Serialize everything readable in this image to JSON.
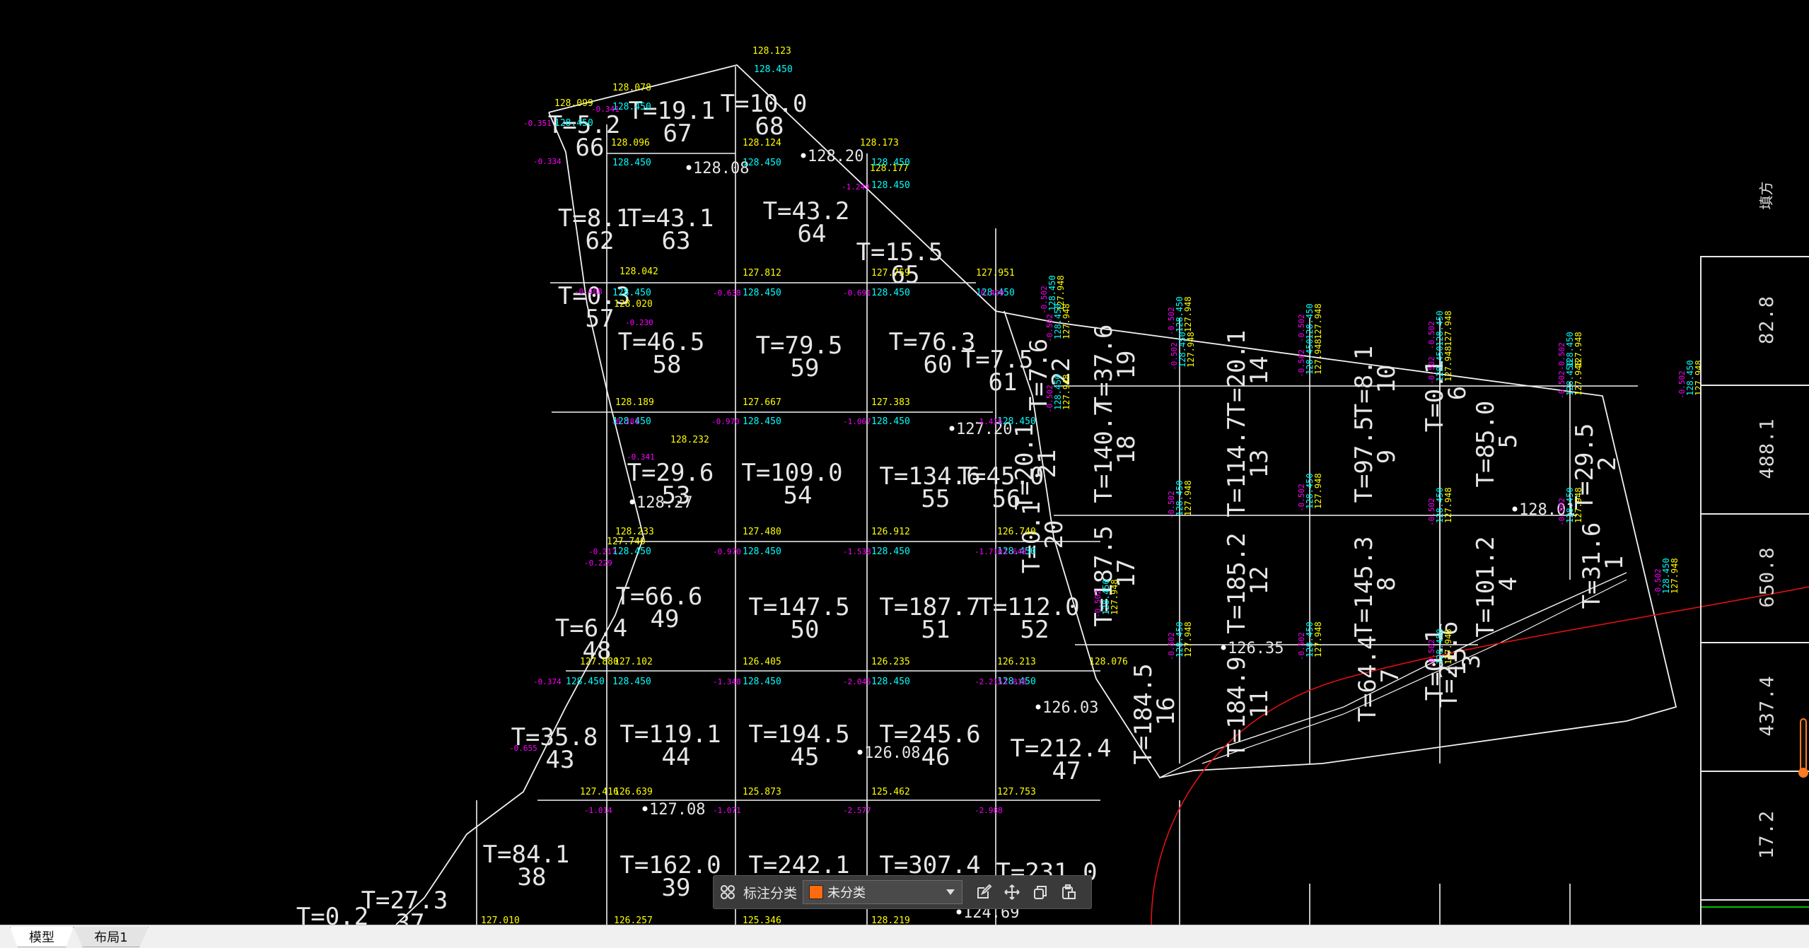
{
  "colors": {
    "canvas_bg": "#000000",
    "grid_line": "#ffffff",
    "elev_yellow": "#ffff00",
    "elev_cyan": "#00ffff",
    "diff_magenta": "#ff00ff",
    "boundary_red": "#e01010",
    "green_line": "#00c000",
    "accent_orange": "#ff6a10"
  },
  "side_panel": {
    "header": "填方",
    "values": [
      "82.8",
      "488.1",
      "650.8",
      "437.4",
      "17.2"
    ]
  },
  "cells": [
    {
      "t": "T=19.1",
      "n": "67"
    },
    {
      "t": "T=10.0",
      "n": "68"
    },
    {
      "t": "T=5.2",
      "n": "66"
    },
    {
      "t": "T=8.1",
      "n": "62"
    },
    {
      "t": "T=43.1",
      "n": "63"
    },
    {
      "t": "T=43.2",
      "n": "64"
    },
    {
      "t": "T=15.5",
      "n": "65"
    },
    {
      "t": "T=0.3",
      "n": "57"
    },
    {
      "t": "T=46.5",
      "n": "58"
    },
    {
      "t": "T=79.5",
      "n": "59"
    },
    {
      "t": "T=76.3",
      "n": "60"
    },
    {
      "t": "T=7.5",
      "n": "61"
    },
    {
      "t": "T=29.6",
      "n": "53"
    },
    {
      "t": "T=109.0",
      "n": "54"
    },
    {
      "t": "T=134.6",
      "n": "55"
    },
    {
      "t": "T=45.0",
      "n": "56"
    },
    {
      "t": "T=6.4",
      "n": "48"
    },
    {
      "t": "T=66.6",
      "n": "49"
    },
    {
      "t": "T=147.5",
      "n": "50"
    },
    {
      "t": "T=187.7",
      "n": "51"
    },
    {
      "t": "T=112.0",
      "n": "52"
    },
    {
      "t": "T=35.8",
      "n": "43"
    },
    {
      "t": "T=119.1",
      "n": "44"
    },
    {
      "t": "T=194.5",
      "n": "45"
    },
    {
      "t": "T=245.6",
      "n": "46"
    },
    {
      "t": "T=212.4",
      "n": "47"
    },
    {
      "t": "T=84.1",
      "n": "38"
    },
    {
      "t": "T=162.0",
      "n": "39"
    },
    {
      "t": "T=242.1",
      "n": "40"
    },
    {
      "t": "T=307.4",
      "n": "41"
    },
    {
      "t": "T=231.0",
      "n": "42"
    },
    {
      "t": "T=27.3",
      "n": "37"
    },
    {
      "t": "T=0.2",
      "n": "36"
    }
  ],
  "rotated_cells": [
    {
      "t": "T=37.6",
      "n": "19"
    },
    {
      "t": "T=20.1",
      "n": "14"
    },
    {
      "t": "T=8.1",
      "n": "10"
    },
    {
      "t": "T=0.1",
      "n": "6"
    },
    {
      "t": "T=140.7",
      "n": "18"
    },
    {
      "t": "T=114.7",
      "n": "13"
    },
    {
      "t": "T=97.5",
      "n": "9"
    },
    {
      "t": "T=85.0",
      "n": "5"
    },
    {
      "t": "T=29.5",
      "n": "2"
    },
    {
      "t": "T=187.5",
      "n": "17"
    },
    {
      "t": "T=185.2",
      "n": "12"
    },
    {
      "t": "T=145.3",
      "n": "8"
    },
    {
      "t": "T=101.2",
      "n": "4"
    },
    {
      "t": "T=31.6",
      "n": "1"
    },
    {
      "t": "T=184.5",
      "n": "16"
    },
    {
      "t": "T=184.9",
      "n": "11"
    },
    {
      "t": "T=64.4",
      "n": "7"
    },
    {
      "t": "T=21.6",
      "n": "3"
    },
    {
      "t": "T=20.1",
      "n": "21"
    },
    {
      "t": "T=7.6",
      "n": "22"
    },
    {
      "t": "T=0.1",
      "n": "20"
    },
    {
      "t": "T=0.1",
      "n": "15"
    }
  ],
  "spot_elevations": [
    "128.08",
    "128.20",
    "127.20",
    "128.27",
    "128.01",
    "126.35",
    "126.03",
    "126.08",
    "127.08",
    "124.69"
  ],
  "yellow_labels": [
    "128.123",
    "128.078",
    "128.099",
    "128.096",
    "128.124",
    "128.173",
    "128.177",
    "128.042",
    "128.020",
    "127.812",
    "127.759",
    "127.951",
    "128.189",
    "127.667",
    "127.383",
    "128.232",
    "128.233",
    "127.480",
    "126.912",
    "126.740",
    "127.880",
    "127.102",
    "126.405",
    "126.235",
    "126.213",
    "128.076",
    "127.416",
    "126.639",
    "125.873",
    "125.462",
    "127.753",
    "127.010",
    "126.257",
    "125.346",
    "128.219",
    "127.740"
  ],
  "cyan_labels": [
    "128.450",
    "128.450",
    "128.450",
    "128.450",
    "128.450",
    "128.450",
    "128.450",
    "128.450",
    "128.450",
    "128.450",
    "128.450",
    "128.450",
    "128.450",
    "128.450",
    "128.450",
    "128.450",
    "128.450",
    "128.450",
    "128.450",
    "128.450",
    "128.450",
    "128.450",
    "128.450",
    "128.450"
  ],
  "magenta_labels": [
    "-0.351",
    "-0.334",
    "-0.341",
    "-0.408",
    "-0.638",
    "-0.691",
    "-0.499",
    "-0.281",
    "-0.970",
    "-1.067",
    "-1.416",
    "-0.217",
    "-0.970",
    "-1.538",
    "-1.710",
    "-1.648",
    "-0.374",
    "-1.348",
    "-2.045",
    "-2.215",
    "-1.816",
    "-1.014",
    "-1.071",
    "-2.577",
    "-2.988",
    "-0.655",
    "-0.229",
    "-0.341",
    "-1.249",
    "-0.230"
  ],
  "toolbar": {
    "label": "标注分类",
    "selected": "未分类",
    "swatch": "#ff6a10"
  },
  "tabs": {
    "model": "模型",
    "layout1": "布局1"
  }
}
